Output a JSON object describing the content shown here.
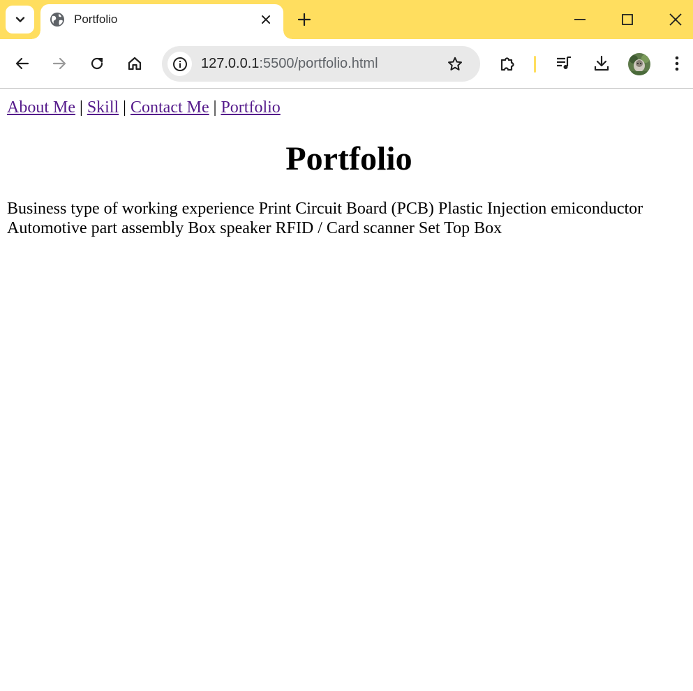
{
  "browser": {
    "tab": {
      "title": "Portfolio"
    },
    "address": {
      "host": "127.0.0.1",
      "path": ":5500/portfolio.html"
    },
    "accent_color": "#ffde5f"
  },
  "page": {
    "nav": {
      "about": "About Me",
      "skill": "Skill",
      "contact": "Contact Me",
      "portfolio": "Portfolio",
      "separator": " | "
    },
    "heading": "Portfolio",
    "text": "Business type of working experience Print Circuit Board (PCB) Plastic Injection emiconductor Automotive part assembly Box speaker RFID / Card scanner Set Top Box",
    "link_color": "#551a8b"
  }
}
